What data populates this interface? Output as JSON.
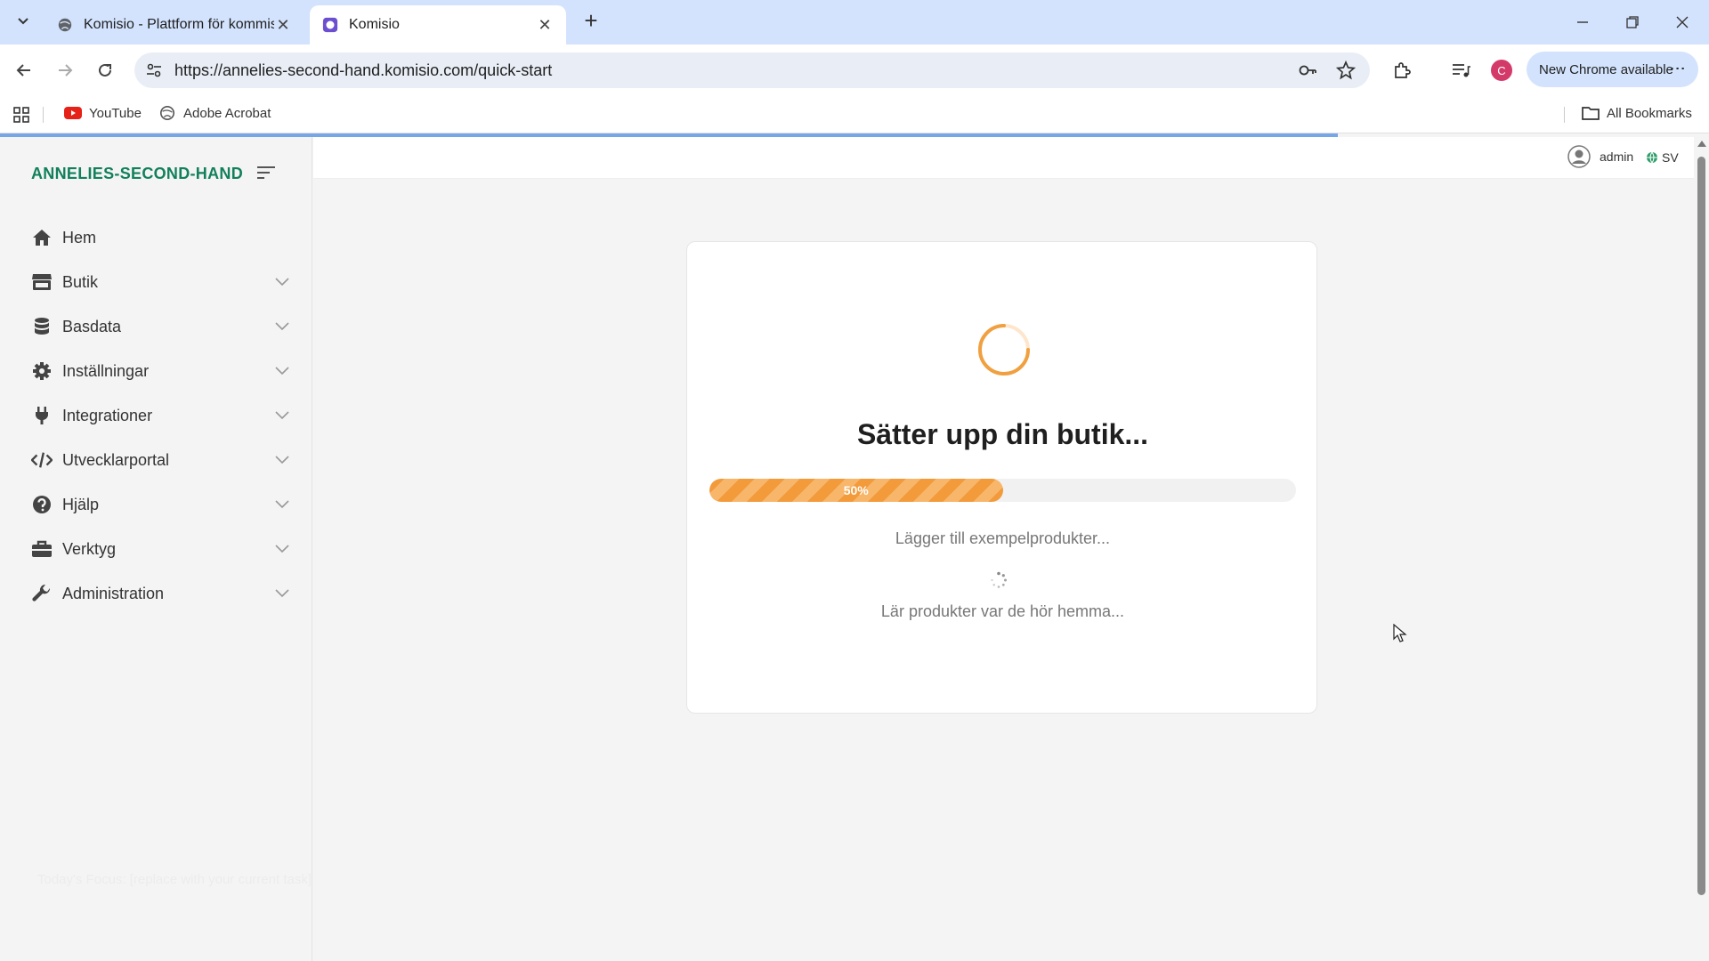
{
  "browser": {
    "tabs": [
      {
        "title": "Komisio - Plattform för kommissionshandel",
        "active": false
      },
      {
        "title": "Komisio",
        "active": true
      }
    ],
    "url": "https://annelies-second-hand.komisio.com/quick-start",
    "profile_initial": "C",
    "update_button": "New Chrome available",
    "bookmarks": [
      {
        "label": "YouTube"
      },
      {
        "label": "Adobe Acrobat"
      }
    ],
    "all_bookmarks": "All Bookmarks"
  },
  "sidebar": {
    "brand": "ANNELIES-SECOND-HAND",
    "items": [
      {
        "label": "Hem",
        "icon": "home-icon",
        "expandable": false
      },
      {
        "label": "Butik",
        "icon": "store-icon",
        "expandable": true
      },
      {
        "label": "Basdata",
        "icon": "database-icon",
        "expandable": true
      },
      {
        "label": "Inställningar",
        "icon": "gear-icon",
        "expandable": true
      },
      {
        "label": "Integrationer",
        "icon": "plug-icon",
        "expandable": true
      },
      {
        "label": "Utvecklarportal",
        "icon": "code-icon",
        "expandable": true
      },
      {
        "label": "Hjälp",
        "icon": "help-icon",
        "expandable": true
      },
      {
        "label": "Verktyg",
        "icon": "toolbox-icon",
        "expandable": true
      },
      {
        "label": "Administration",
        "icon": "wrench-icon",
        "expandable": true
      }
    ],
    "focus_note": "Today's Focus: [replace with your current task]"
  },
  "header": {
    "user": "admin",
    "language": "SV"
  },
  "setup": {
    "heading": "Sätter upp din butik...",
    "progress_percent": 50,
    "progress_label": "50%",
    "status_primary": "Lägger till exempelprodukter...",
    "status_secondary": "Lär produkter var de hör hemma..."
  },
  "colors": {
    "brand": "#12805c",
    "accent": "#f39a3a",
    "top_progress": "#76a5e8"
  }
}
